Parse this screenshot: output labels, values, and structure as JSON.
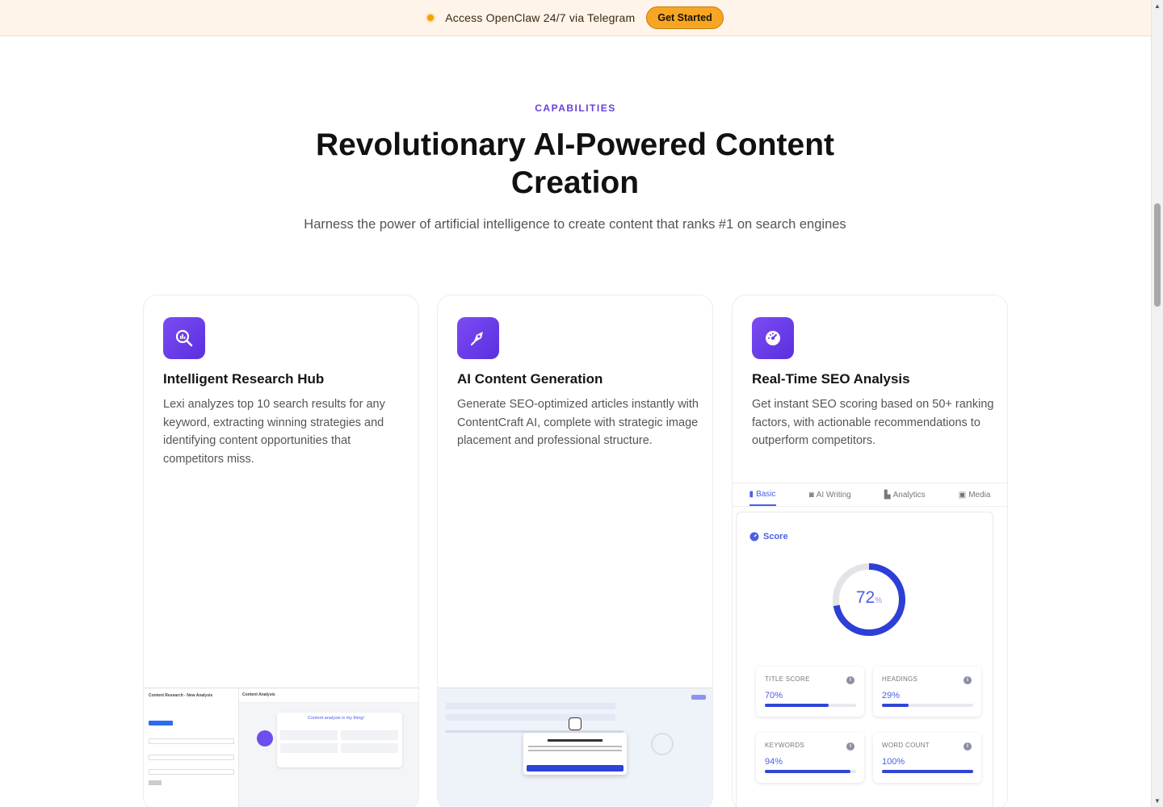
{
  "banner": {
    "text": "Access OpenClaw 24/7 via Telegram",
    "cta": "Get Started"
  },
  "section": {
    "eyebrow": "CAPABILITIES",
    "headline": "Revolutionary AI-Powered Content Creation",
    "subhead": "Harness the power of artificial intelligence to create content that ranks #1 on search engines"
  },
  "cards": [
    {
      "icon": "search-chart-icon",
      "title": "Intelligent Research Hub",
      "desc": "Lexi analyzes top 10 search results for any keyword, extracting winning strategies and identifying content opportunities that competitors miss."
    },
    {
      "icon": "pen-nib-icon",
      "title": "AI Content Generation",
      "desc": "Generate SEO-optimized articles instantly with ContentCraft AI, complete with strategic image placement and professional structure."
    },
    {
      "icon": "gauge-icon",
      "title": "Real-Time SEO Analysis",
      "desc": "Get instant SEO scoring based on 50+ ranking factors, with actionable recommendations to outperform competitors."
    }
  ],
  "shot1": {
    "side_title": "Content Research - New Analysis",
    "panel_title": "Content Analysis",
    "card_title": "Content analysis is my thing!"
  },
  "seo": {
    "tabs": [
      "Basic",
      "AI Writing",
      "Analytics",
      "Media"
    ],
    "score_label": "Score",
    "score": "72",
    "score_unit": "%",
    "score_value": 72,
    "metrics": [
      {
        "label": "TITLE SCORE",
        "value": "70%",
        "pct": 70
      },
      {
        "label": "HEADINGS",
        "value": "29%",
        "pct": 29
      },
      {
        "label": "KEYWORDS",
        "value": "94%",
        "pct": 94
      },
      {
        "label": "WORD COUNT",
        "value": "100%",
        "pct": 100
      }
    ]
  },
  "colors": {
    "accent": "#4b5ee6",
    "brand": "#6b3fd9",
    "banner_cta": "#f6a623"
  }
}
